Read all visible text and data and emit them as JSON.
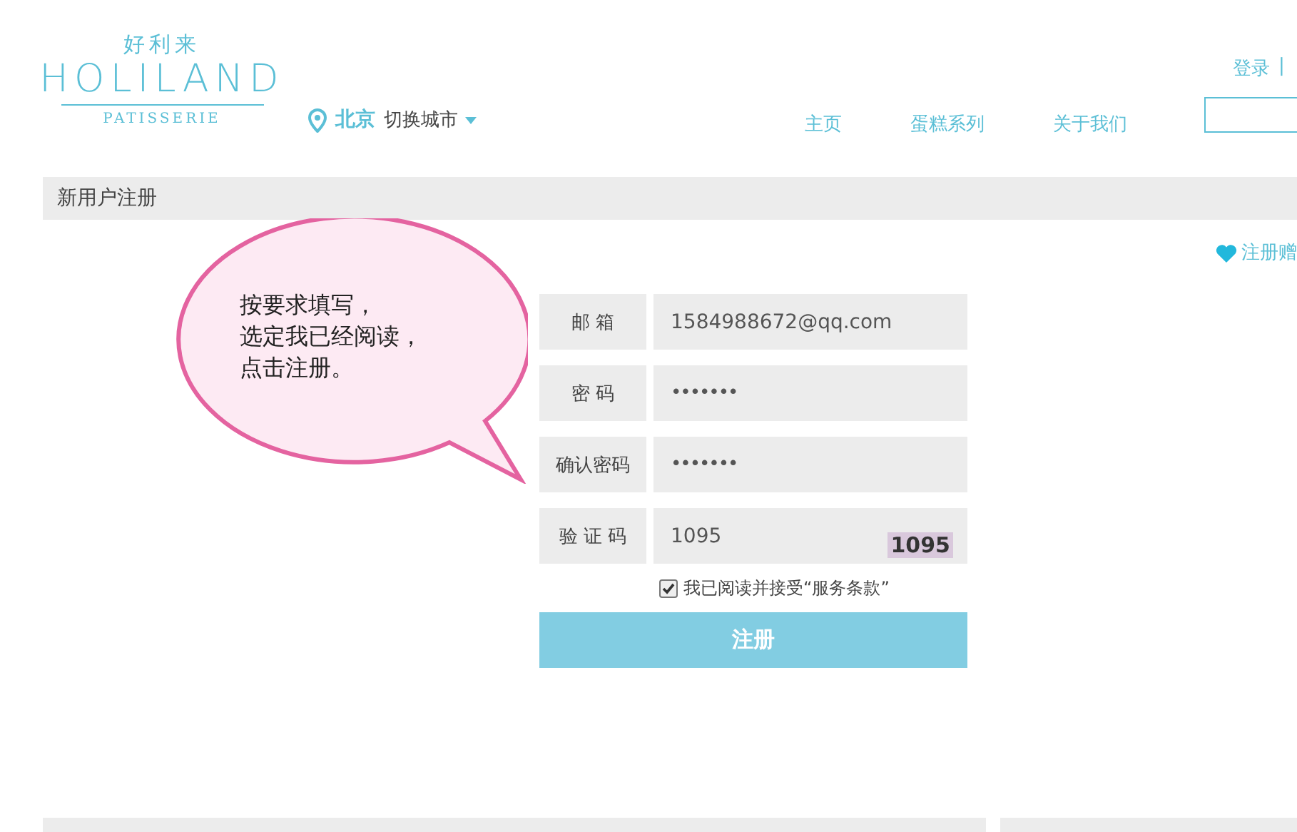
{
  "brand": {
    "chinese": "好利来",
    "name": "HOLILAND",
    "tagline": "PATISSERIE"
  },
  "location": {
    "city": "北京",
    "switch": "切换城市"
  },
  "nav": [
    {
      "label": "主页",
      "selected": false
    },
    {
      "label": "蛋糕系列",
      "selected": false
    },
    {
      "label": "关于我们",
      "selected": false
    }
  ],
  "top_links": {
    "login": "登录",
    "separator": "|"
  },
  "section_title": "新用户注册",
  "promo": "注册赠",
  "bubble": {
    "lines": [
      "按要求填写，",
      "选定我已经阅读，",
      "点击注册。"
    ]
  },
  "form": {
    "fields": [
      {
        "label": "邮 箱",
        "kind": "text",
        "value": "1584988672@qq.com"
      },
      {
        "label": "密 码",
        "kind": "password",
        "value": "•••••••"
      },
      {
        "label": "确认密码",
        "kind": "password",
        "value": "•••••••"
      },
      {
        "label": "验 证 码",
        "kind": "captcha",
        "value": "1095",
        "captcha": "1095"
      }
    ],
    "agree": {
      "label": "我已阅读并接受“服务条款”",
      "checked": true
    },
    "submit": "注册"
  }
}
